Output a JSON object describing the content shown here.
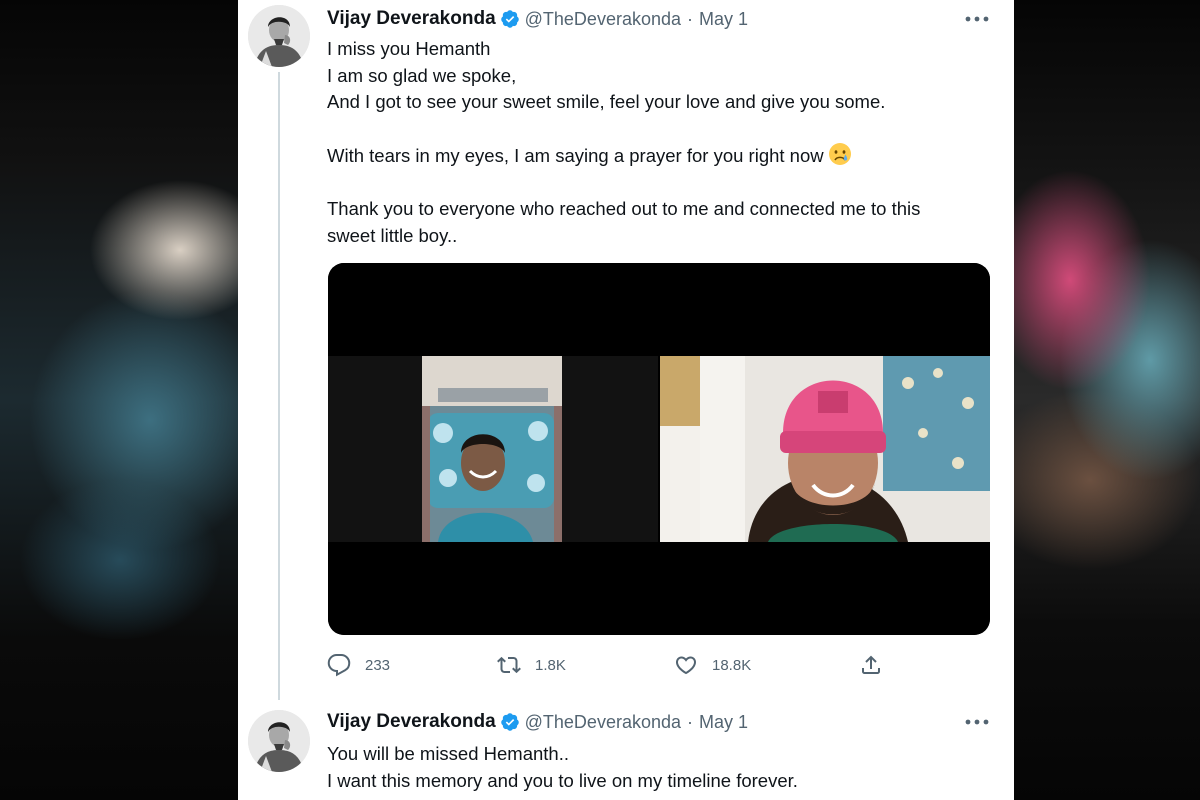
{
  "tweets": [
    {
      "author": {
        "name": "Vijay Deverakonda",
        "handle": "@TheDeverakonda",
        "verified": true
      },
      "date": "May 1",
      "separator": "·",
      "text": {
        "line1": "I miss you Hemanth",
        "line2": "I am so glad we spoke,",
        "line3": "And I got to see your sweet smile, feel your love and give you some.",
        "line4": "With tears in my eyes, I am saying a prayer for you right now",
        "line5": "Thank you to everyone who reached out to me and connected me to this",
        "line6": "sweet little boy.."
      },
      "emoji": "crying-face",
      "media": {
        "type": "video-call-screenshot",
        "panels": [
          "boy-in-hospital-bed",
          "man-in-pink-beanie"
        ]
      },
      "stats": {
        "replies": "233",
        "retweets": "1.8K",
        "likes": "18.8K"
      }
    },
    {
      "author": {
        "name": "Vijay Deverakonda",
        "handle": "@TheDeverakonda",
        "verified": true
      },
      "date": "May 1",
      "separator": "·",
      "text": {
        "line1": "You will be missed Hemanth..",
        "line2": "I want this memory and you to live on my timeline forever."
      }
    }
  ],
  "colors": {
    "verified": "#1d9bf0",
    "text_primary": "#0f1419",
    "text_secondary": "#536471",
    "thread_line": "#cfd9de"
  },
  "icons": [
    "verified-badge-icon",
    "more-options-icon",
    "reply-icon",
    "retweet-icon",
    "like-icon",
    "share-icon"
  ]
}
